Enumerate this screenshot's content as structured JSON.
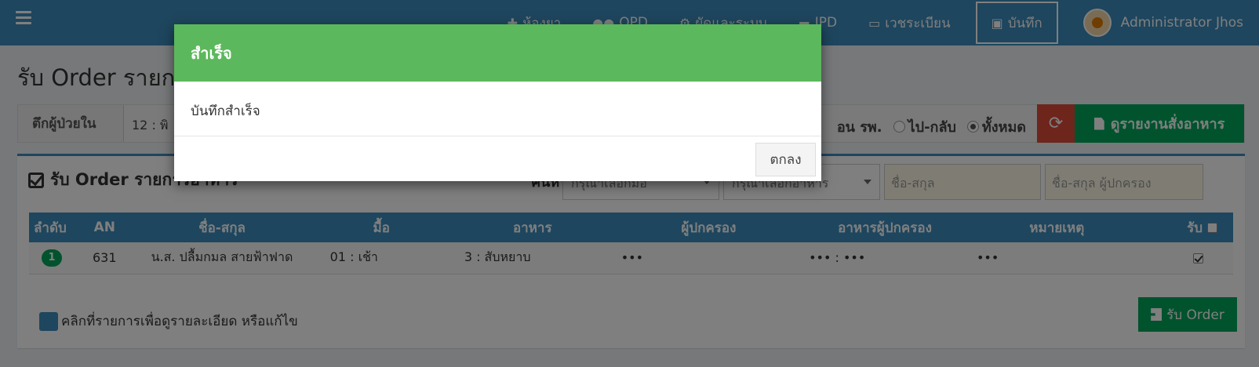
{
  "navbar": {
    "items": [
      {
        "label": "ห้องยา",
        "icon": "medkit-icon"
      },
      {
        "label": "OPD",
        "icon": "users-icon"
      },
      {
        "label": "ผัดและระบบ",
        "icon": "gears-icon"
      },
      {
        "label": "IPD",
        "icon": "bed-icon"
      },
      {
        "label": "เวชระเบียน",
        "icon": "card-icon"
      },
      {
        "label": "บันทึก",
        "icon": "save-icon"
      }
    ],
    "user": "Administrator Jhos"
  },
  "page": {
    "title": "รับ Order รายก"
  },
  "filter": {
    "ward_label": "ตึกผู้ป่วยใน",
    "ward_value": "12 : พิ",
    "radio_partial": "อน รพ.",
    "radio_roundtrip": "ไป-กลับ",
    "radio_all": "ทั้งหมด",
    "report_button": "ดูรายงานสั่งอาหาร"
  },
  "box": {
    "title": "รับ Order รายการอาหาร",
    "filter_label": "ค้นหา",
    "meal_select": "กรุณาเลือกมื้อ",
    "food_select": "กรุณาเลือกอาหาร",
    "name_placeholder": "ชื่อ-สกุล",
    "guardian_placeholder": "ชื่อ-สกุล ผู้ปกครอง"
  },
  "table": {
    "headers": [
      "ลำดับ",
      "AN",
      "ชื่อ-สกุล",
      "มื้อ",
      "อาหาร",
      "ผู้ปกครอง",
      "อาหารผู้ปกครอง",
      "หมายเหตุ",
      "รับ"
    ],
    "rows": [
      {
        "no": "1",
        "an": "631",
        "name": "น.ส. ปลื้มกมล สายฟ้าฟาด",
        "meal": "01 : เช้า",
        "food": "3 : สับหยาบ",
        "guardian": "•••",
        "guardian_food": "••• : •••",
        "note": "•••",
        "received": true
      }
    ]
  },
  "legend": "คลิกที่รายการเพื่อดูรายละเอียด หรือแก้ไข",
  "receive_button": "รับ Order",
  "modal": {
    "title": "สำเร็จ",
    "message": "บันทึกสำเร็จ",
    "ok_button": "ตกลง"
  },
  "colors": {
    "primary": "#3c8dbc",
    "success": "#00a65a",
    "danger": "#dd4b39",
    "modal_header": "#5cb85c"
  }
}
